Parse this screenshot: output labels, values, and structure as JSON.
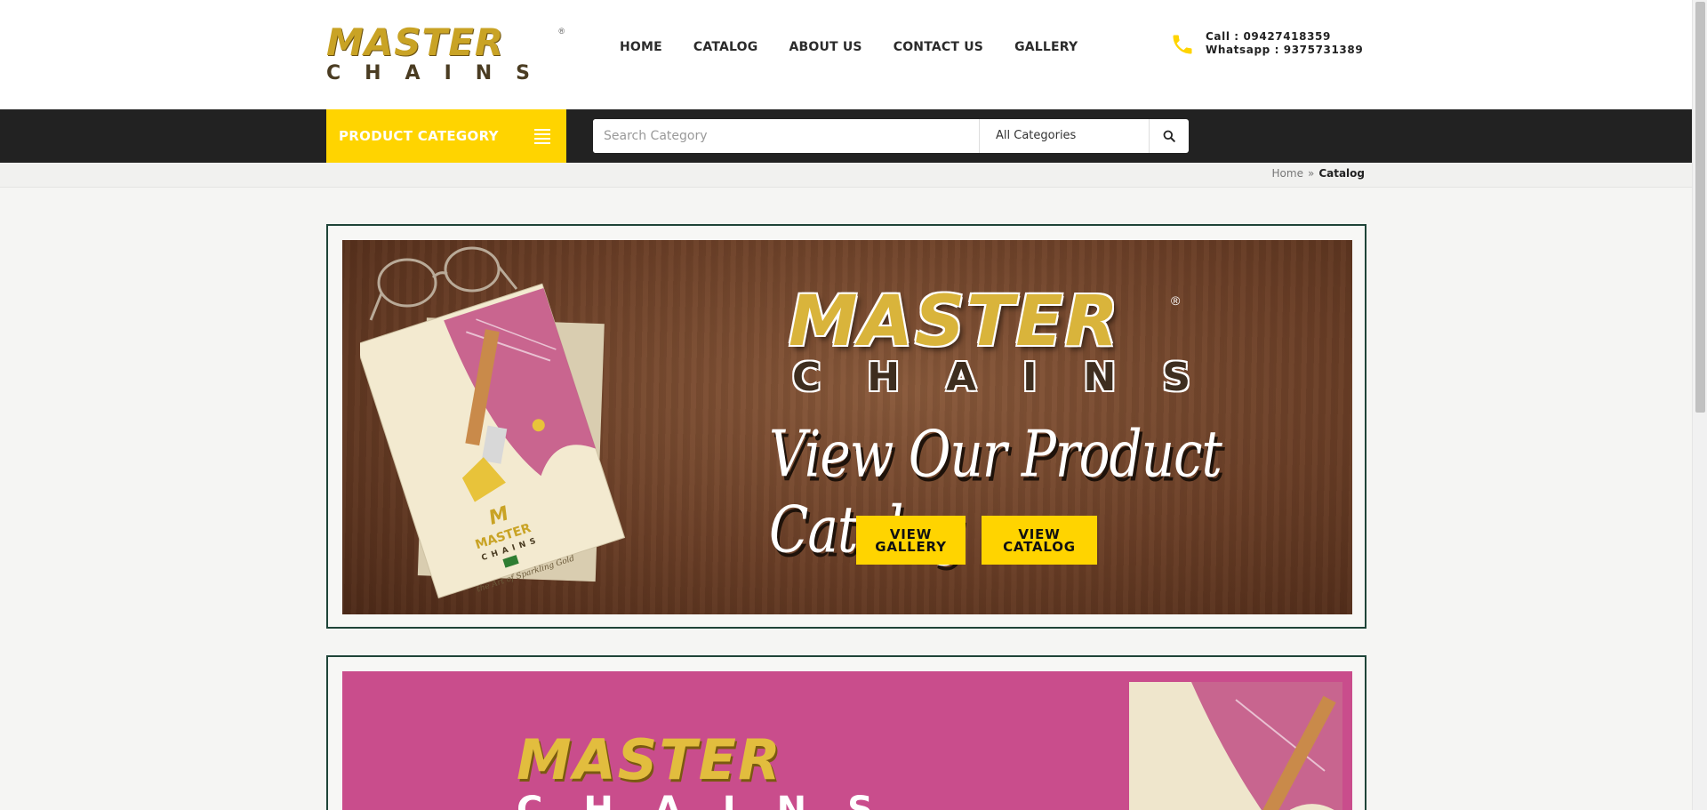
{
  "logo": {
    "word1": "MASTER",
    "word2": "CHAINS",
    "reg": "®"
  },
  "nav": {
    "items": [
      "HOME",
      "CATALOG",
      "ABOUT US",
      "CONTACT US",
      "GALLERY"
    ]
  },
  "contact": {
    "call": "Call : 09427418359",
    "whatsapp": "Whatsapp : 9375731389",
    "icon": "phone-icon",
    "icon_color": "#ffd400"
  },
  "category_bar": {
    "label": "PRODUCT CATEGORY",
    "accent": "#ffd400",
    "bar_color": "#222222"
  },
  "search": {
    "placeholder": "Search Category",
    "select_value": "All Categories",
    "icon": "search-icon"
  },
  "breadcrumb": {
    "home": "Home",
    "separator": "»",
    "current": "Catalog"
  },
  "banner1": {
    "brand_top": "MASTER",
    "brand_bottom": "CHAINS",
    "reg": "®",
    "headline": "View Our Product Catalog",
    "btn_gallery": [
      "VIEW",
      "GALLERY"
    ],
    "btn_catalog": [
      "VIEW",
      "CATALOG"
    ],
    "catalog_cover": {
      "brand_top": "MASTER",
      "brand_bottom": "CHAINS",
      "tagline": "the Art of Sparkling Gold"
    }
  },
  "banner2": {
    "brand_top": "MASTER",
    "brand_bottom": "CHAINS",
    "bg": "#c94d8c"
  }
}
